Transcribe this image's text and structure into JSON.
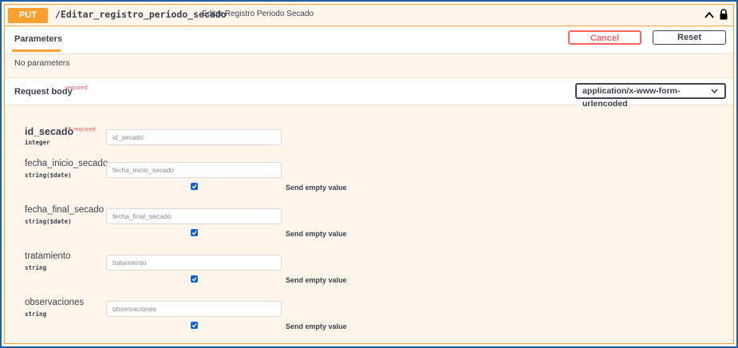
{
  "operation": {
    "method": "PUT",
    "path": "/Editar_registro_periodo_secado",
    "description": "Editar Registro Periodo Secado"
  },
  "tabs": {
    "parameters": "Parameters"
  },
  "buttons": {
    "cancel": "Cancel",
    "reset": "Reset"
  },
  "no_params": "No parameters",
  "request_body": {
    "label": "Request body",
    "required": "required",
    "content_type": "application/x-www-form-urlencoded"
  },
  "fields": [
    {
      "name": "id_secado",
      "required_mark": "*",
      "required": "required",
      "type": "integer",
      "placeholder": "id_secado"
    },
    {
      "name": "fecha_inicio_secado",
      "type": "string($date)",
      "placeholder": "fecha_inicio_secado",
      "send_empty": "Send empty value"
    },
    {
      "name": "fecha_final_secado",
      "type": "string($date)",
      "placeholder": "fecha_final_secado",
      "send_empty": "Send empty value"
    },
    {
      "name": "tratamiento",
      "type": "string",
      "placeholder": "tratamiento",
      "send_empty": "Send empty value"
    },
    {
      "name": "observaciones",
      "type": "string",
      "placeholder": "observaciones",
      "send_empty": "Send empty value"
    }
  ],
  "colors": {
    "put": "#fca130",
    "danger": "#ff6060",
    "text": "#3b4151",
    "checkbox": "#0b63d6"
  },
  "icons": {
    "collapse": "chevron-up-icon",
    "lock": "lock-icon",
    "dropdown": "chevron-down-icon"
  }
}
